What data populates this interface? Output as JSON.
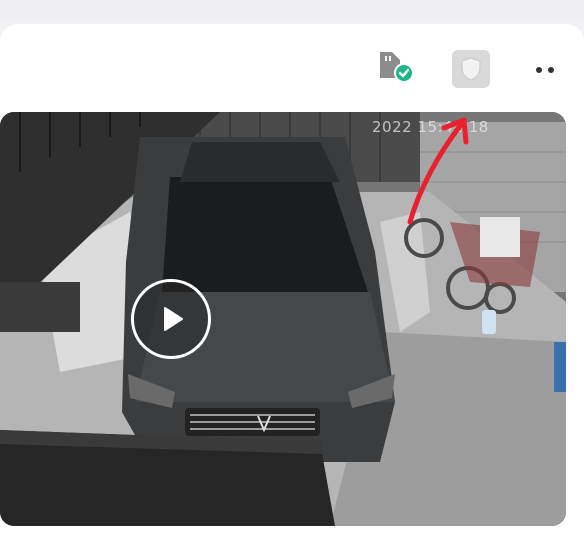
{
  "camera_card": {
    "sd_card_status": "sd-card-ok-icon",
    "privacy_mode": "shield-icon",
    "more_menu": "more-horizontal-icon"
  },
  "video": {
    "timestamp": "2022   15:41:18",
    "play_icon": "play-icon"
  },
  "colors": {
    "status_green": "#1fb58a",
    "annotation_red": "#e8212f",
    "card_bg": "#ffffff",
    "page_bg": "#f2f2f4"
  }
}
